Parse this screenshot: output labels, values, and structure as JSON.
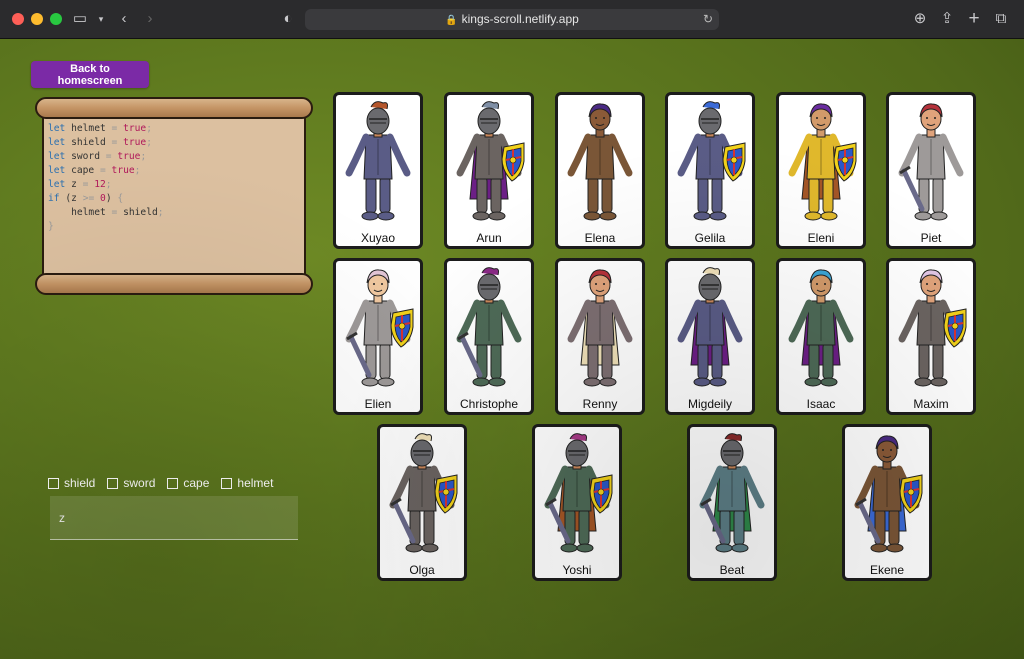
{
  "browser": {
    "url": "kings-scroll.netlify.app"
  },
  "page": {
    "home_button": "Back to homescreen",
    "code_lines": [
      [
        {
          "t": "let",
          "c": "kw"
        },
        {
          "t": " helmet "
        },
        {
          "t": "=",
          "c": "punc"
        },
        {
          "t": " "
        },
        {
          "t": "true",
          "c": "bool"
        },
        {
          "t": ";",
          "c": "punc"
        }
      ],
      [
        {
          "t": "let",
          "c": "kw"
        },
        {
          "t": " shield "
        },
        {
          "t": "=",
          "c": "punc"
        },
        {
          "t": " "
        },
        {
          "t": "true",
          "c": "bool"
        },
        {
          "t": ";",
          "c": "punc"
        }
      ],
      [
        {
          "t": "let",
          "c": "kw"
        },
        {
          "t": " sword "
        },
        {
          "t": "=",
          "c": "punc"
        },
        {
          "t": " "
        },
        {
          "t": "true",
          "c": "bool"
        },
        {
          "t": ";",
          "c": "punc"
        }
      ],
      [
        {
          "t": "let",
          "c": "kw"
        },
        {
          "t": " cape "
        },
        {
          "t": "=",
          "c": "punc"
        },
        {
          "t": " "
        },
        {
          "t": "true",
          "c": "bool"
        },
        {
          "t": ";",
          "c": "punc"
        }
      ],
      [
        {
          "t": "let",
          "c": "kw"
        },
        {
          "t": " z "
        },
        {
          "t": "=",
          "c": "punc"
        },
        {
          "t": " "
        },
        {
          "t": "12",
          "c": "num"
        },
        {
          "t": ";",
          "c": "punc"
        }
      ],
      [
        {
          "t": "if",
          "c": "kw"
        },
        {
          "t": " ("
        },
        {
          "t": "z "
        },
        {
          "t": ">=",
          "c": "punc"
        },
        {
          "t": " "
        },
        {
          "t": "0",
          "c": "num"
        },
        {
          "t": ") "
        },
        {
          "t": "{",
          "c": "punc"
        }
      ],
      [
        {
          "t": "    helmet "
        },
        {
          "t": "=",
          "c": "punc"
        },
        {
          "t": " shield"
        },
        {
          "t": ";",
          "c": "punc"
        }
      ],
      [
        {
          "t": "}",
          "c": "punc"
        }
      ]
    ],
    "filters": [
      "shield",
      "sword",
      "cape",
      "helmet"
    ],
    "answer_placeholder": "z",
    "characters": [
      {
        "name": "Xuyao",
        "body": "#5a5c86",
        "hair": "#b5562b",
        "helmet": true,
        "shield": false,
        "sword": false,
        "cape": null,
        "skin": "#c9875a"
      },
      {
        "name": "Arun",
        "body": "#6b6461",
        "hair": "#7f8fa6",
        "helmet": true,
        "shield": true,
        "sword": false,
        "cape": "#6c1f86",
        "skin": "#c9875a"
      },
      {
        "name": "Elena",
        "body": "#7a5637",
        "hair": "#4a2a84",
        "helmet": false,
        "shield": false,
        "sword": false,
        "cape": null,
        "skin": "#8a5a38"
      },
      {
        "name": "Gelila",
        "body": "#5a5c86",
        "hair": "#3b6ad6",
        "helmet": true,
        "shield": true,
        "sword": false,
        "cape": null,
        "skin": "#c9875a"
      },
      {
        "name": "Eleni",
        "body": "#e0b82c",
        "hair": "#6a2ca0",
        "helmet": false,
        "shield": true,
        "sword": false,
        "cape": "#a45626",
        "skin": "#d29a6a"
      },
      {
        "name": "Piet",
        "body": "#9e9a99",
        "hair": "#b5323b",
        "helmet": false,
        "shield": false,
        "sword": true,
        "cape": null,
        "skin": "#e0a37b"
      },
      {
        "name": "Elien",
        "body": "#9e9a99",
        "hair": "#e2c6d6",
        "helmet": false,
        "shield": true,
        "sword": true,
        "cape": null,
        "skin": "#f0c8a0"
      },
      {
        "name": "Christophe",
        "body": "#4e6a57",
        "hair": "#8a2a86",
        "helmet": true,
        "shield": false,
        "sword": true,
        "cape": null,
        "skin": "#c9875a"
      },
      {
        "name": "Renny",
        "body": "#7d6f72",
        "hair": "#b5323b",
        "helmet": false,
        "shield": false,
        "sword": false,
        "cape": "#efe0b8",
        "skin": "#e0a37b"
      },
      {
        "name": "Migdeily",
        "body": "#5a5c86",
        "hair": "#efe0b8",
        "helmet": true,
        "shield": false,
        "sword": false,
        "cape": "#6c1f86",
        "skin": "#c9875a"
      },
      {
        "name": "Isaac",
        "body": "#4e6a57",
        "hair": "#3ba6d6",
        "helmet": false,
        "shield": false,
        "sword": false,
        "cape": "#6c1f86",
        "skin": "#d29a6a"
      },
      {
        "name": "Maxim",
        "body": "#6b6461",
        "hair": "#e2c6e6",
        "helmet": false,
        "shield": true,
        "sword": false,
        "cape": null,
        "skin": "#e0a37b"
      },
      {
        "name": "Olga",
        "body": "#6b6461",
        "hair": "#efe0b8",
        "helmet": true,
        "shield": true,
        "sword": true,
        "cape": null,
        "skin": "#c9875a"
      },
      {
        "name": "Yoshi",
        "body": "#4e6a57",
        "hair": "#a63a86",
        "helmet": true,
        "shield": true,
        "sword": true,
        "cape": "#a45626",
        "skin": "#c9875a"
      },
      {
        "name": "Beat",
        "body": "#5e8088",
        "hair": "#8a2a2a",
        "helmet": true,
        "shield": false,
        "sword": true,
        "cape": "#2f8a4a",
        "skin": "#c9875a"
      },
      {
        "name": "Ekene",
        "body": "#7a5637",
        "hair": "#4a2a84",
        "helmet": false,
        "shield": true,
        "sword": true,
        "cape": "#3b6ad6",
        "skin": "#8a5a38"
      }
    ]
  }
}
